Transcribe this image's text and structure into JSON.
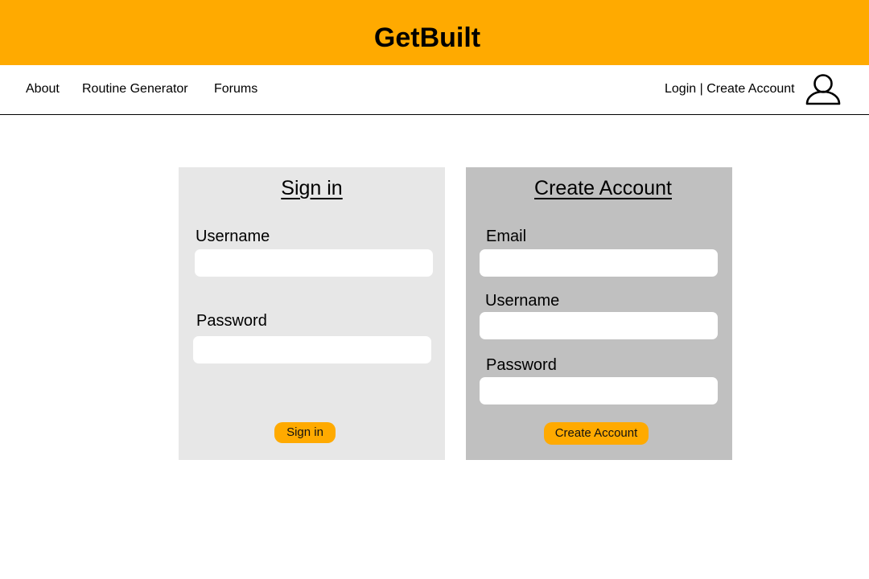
{
  "header": {
    "brand": "GetBuilt"
  },
  "nav": {
    "items": [
      "About",
      "Routine Generator",
      "Forums"
    ],
    "login_label": "Login",
    "separator": " | ",
    "create_account_label": "Create Account",
    "account_icon": "user-icon"
  },
  "signin": {
    "title": "Sign in",
    "username_label": "Username",
    "username_value": "",
    "password_label": "Password",
    "password_value": "",
    "submit_label": "Sign in"
  },
  "create_account": {
    "title": "Create Account",
    "email_label": "Email",
    "email_value": "",
    "username_label": "Username",
    "username_value": "",
    "password_label": "Password",
    "password_value": "",
    "submit_label": "Create Account"
  },
  "colors": {
    "accent": "#ffaa00",
    "signin_panel": "#e7e7e7",
    "create_panel": "#c0c0c0"
  }
}
